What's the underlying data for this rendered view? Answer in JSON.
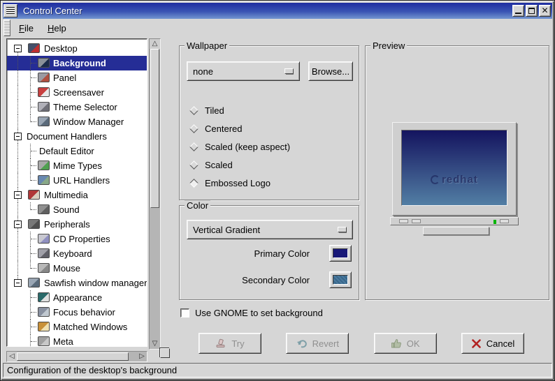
{
  "window": {
    "title": "Control Center",
    "statusbar": "Configuration of the desktop's background"
  },
  "menubar": {
    "items": [
      {
        "label": "File"
      },
      {
        "label": "Help"
      }
    ]
  },
  "tree": {
    "items": [
      {
        "label": "Desktop",
        "level": 0,
        "expandable": true,
        "icon": "desktop",
        "selected": false
      },
      {
        "label": "Background",
        "level": 1,
        "expandable": false,
        "icon": "background",
        "selected": true
      },
      {
        "label": "Panel",
        "level": 1,
        "expandable": false,
        "icon": "panel",
        "selected": false
      },
      {
        "label": "Screensaver",
        "level": 1,
        "expandable": false,
        "icon": "screensaver",
        "selected": false
      },
      {
        "label": "Theme Selector",
        "level": 1,
        "expandable": false,
        "icon": "theme-selector",
        "selected": false
      },
      {
        "label": "Window Manager",
        "level": 1,
        "expandable": false,
        "icon": "window-manager",
        "selected": false
      },
      {
        "label": "Document Handlers",
        "level": 0,
        "expandable": true,
        "icon": null,
        "selected": false
      },
      {
        "label": "Default Editor",
        "level": 1,
        "expandable": false,
        "icon": null,
        "selected": false
      },
      {
        "label": "Mime Types",
        "level": 1,
        "expandable": false,
        "icon": "mime-types",
        "selected": false
      },
      {
        "label": "URL Handlers",
        "level": 1,
        "expandable": false,
        "icon": "url-handlers",
        "selected": false
      },
      {
        "label": "Multimedia",
        "level": 0,
        "expandable": true,
        "icon": "multimedia",
        "selected": false
      },
      {
        "label": "Sound",
        "level": 1,
        "expandable": false,
        "icon": "sound",
        "selected": false
      },
      {
        "label": "Peripherals",
        "level": 0,
        "expandable": true,
        "icon": "peripherals",
        "selected": false
      },
      {
        "label": "CD Properties",
        "level": 1,
        "expandable": false,
        "icon": "cd-properties",
        "selected": false
      },
      {
        "label": "Keyboard",
        "level": 1,
        "expandable": false,
        "icon": "keyboard",
        "selected": false
      },
      {
        "label": "Mouse",
        "level": 1,
        "expandable": false,
        "icon": "mouse",
        "selected": false
      },
      {
        "label": "Sawfish window manager",
        "level": 0,
        "expandable": true,
        "icon": "sawfish",
        "selected": false
      },
      {
        "label": "Appearance",
        "level": 1,
        "expandable": false,
        "icon": "appearance",
        "selected": false
      },
      {
        "label": "Focus behavior",
        "level": 1,
        "expandable": false,
        "icon": "focus-behavior",
        "selected": false
      },
      {
        "label": "Matched Windows",
        "level": 1,
        "expandable": false,
        "icon": "matched-windows",
        "selected": false
      },
      {
        "label": "Meta",
        "level": 1,
        "expandable": false,
        "icon": "meta",
        "selected": false
      }
    ],
    "icon_colors": {
      "desktop": [
        "#44506a",
        "#c03030"
      ],
      "background": [
        "#8a9098",
        "#1a2a4a"
      ],
      "panel": [
        "#9a9aa2",
        "#b05040"
      ],
      "screensaver": [
        "#c84040",
        "#e8e8e8"
      ],
      "theme-selector": [
        "#b0b0b8",
        "#707078"
      ],
      "window-manager": [
        "#9aa6b4",
        "#5a6a7a"
      ],
      "mime-types": [
        "#a8a8a8",
        "#50a050"
      ],
      "url-handlers": [
        "#6888b0",
        "#88a888"
      ],
      "multimedia": [
        "#b03838",
        "#d8d0c0"
      ],
      "sound": [
        "#909090",
        "#606060"
      ],
      "peripherals": [
        "#787878",
        "#505050"
      ],
      "cd-properties": [
        "#c8c8d0",
        "#9090c0"
      ],
      "keyboard": [
        "#a0a0a8",
        "#606068"
      ],
      "mouse": [
        "#b8b8b8",
        "#888888"
      ],
      "sawfish": [
        "#9aa6b4",
        "#5a6a7a"
      ],
      "appearance": [
        "#2a6a6a",
        "#e0e0e0"
      ],
      "focus-behavior": [
        "#8890a0",
        "#c0c8d0"
      ],
      "matched-windows": [
        "#c89038",
        "#f0e0b0"
      ],
      "meta": [
        "#a0a0a0",
        "#c8c8c8"
      ]
    }
  },
  "wallpaper": {
    "legend": "Wallpaper",
    "selected_wallpaper": "none",
    "browse_label": "Browse...",
    "modes": [
      {
        "label": "Tiled",
        "selected": false
      },
      {
        "label": "Centered",
        "selected": false
      },
      {
        "label": "Scaled (keep aspect)",
        "selected": false
      },
      {
        "label": "Scaled",
        "selected": false
      },
      {
        "label": "Embossed Logo",
        "selected": true
      }
    ]
  },
  "color": {
    "legend": "Color",
    "gradient_type": "Vertical Gradient",
    "primary": {
      "label": "Primary Color",
      "color": "#181878"
    },
    "secondary": {
      "label": "Secondary Color",
      "color": "#4a7a9e"
    }
  },
  "preview": {
    "legend": "Preview",
    "logo_text": "redhat",
    "screen_gradient_top": "#14145f",
    "screen_gradient_bottom": "#527ea4",
    "power_led_color": "#00b400"
  },
  "gnome_option": {
    "label": "Use GNOME to set background",
    "checked": false
  },
  "actions": [
    {
      "label": "Try",
      "icon": "try",
      "enabled": false
    },
    {
      "label": "Revert",
      "icon": "revert",
      "enabled": false
    },
    {
      "label": "OK",
      "icon": "ok",
      "enabled": false
    },
    {
      "label": "Cancel",
      "icon": "cancel",
      "enabled": true
    }
  ],
  "colors": {
    "selection": "#252d96",
    "titlebar_top": "#1f2da0",
    "titlebar_bottom": "#7396d0",
    "cancel_x": "#b22222"
  }
}
